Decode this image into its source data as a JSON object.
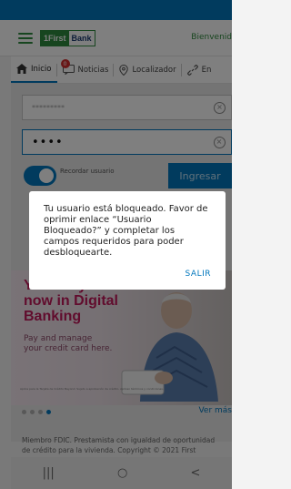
{
  "header": {
    "logo_number": "1",
    "logo_first": "First",
    "logo_bank": "Bank",
    "welcome": "Bienvenid"
  },
  "tabs": [
    {
      "label": "Inicio",
      "icon": "home-icon"
    },
    {
      "label": "Noticias",
      "icon": "chat-icon",
      "badge": "0"
    },
    {
      "label": "Localizador",
      "icon": "location-icon"
    },
    {
      "label": "En",
      "icon": "link-icon"
    }
  ],
  "login": {
    "username_masked": "*********",
    "password_masked": "••••",
    "remember_label": "Recordar usuario",
    "login_button": "Ingresar"
  },
  "promo": {
    "headline_1": "Your Beyond",
    "headline_2": "now in Digital",
    "headline_3": "Banking",
    "sub_1": "Pay and manage",
    "sub_2": "your credit card here.",
    "fine_print": "Aplica para la Tarjeta de Crédito Beyond. Sujeto a aprobación de crédito. Aplican términos y condiciones."
  },
  "carousel": {
    "more_link": "Ver más"
  },
  "footer": {
    "line_1": "Miembro FDIC. Prestamista con igualdad de oportunidad",
    "line_2": "de crédito para la vivienda. Copyright © 2021 First"
  },
  "dialog": {
    "message": "Tu usuario está bloqueado. Favor de oprimir enlace “Usuario Bloqueado?” y completar los campos requeridos para poder desbloquearte.",
    "action": "SALIR"
  },
  "nav": {
    "recent": "|||",
    "home": "○",
    "back": "<"
  },
  "colors": {
    "primary": "#0277bd",
    "brand_green": "#2f8a3e",
    "promo_magenta": "#c2185b"
  }
}
